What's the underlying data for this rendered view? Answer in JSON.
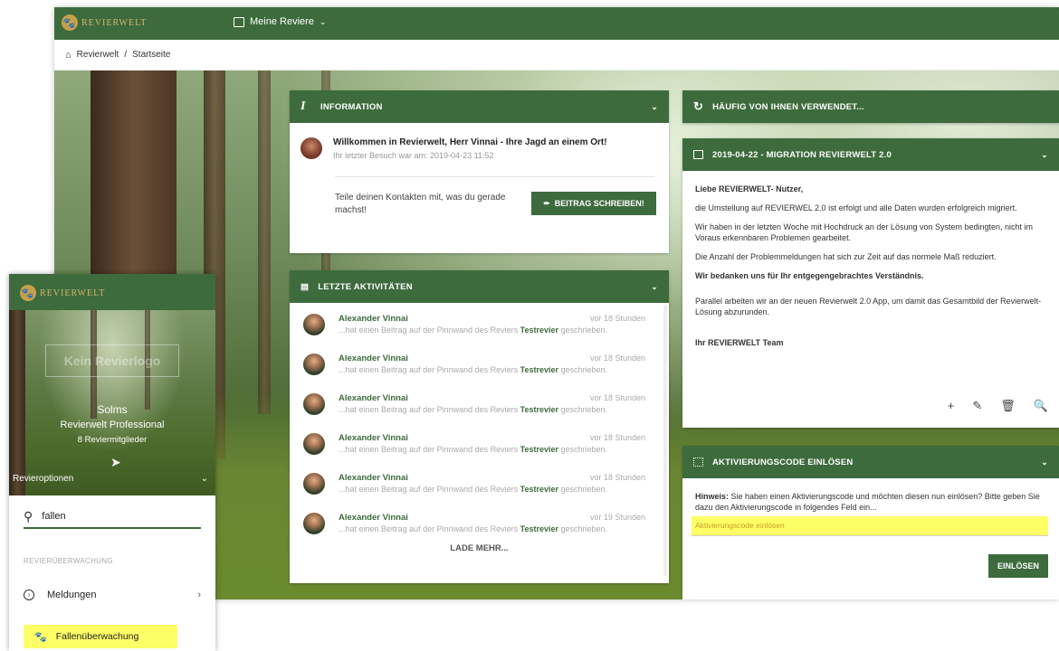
{
  "app": {
    "brand": "REVIERWELT"
  },
  "topbar": {
    "revier_menu": "Meine Reviere",
    "chevron": "⌄"
  },
  "breadcrumb": {
    "root": "Revierwelt",
    "separator": "/",
    "current": "Startseite"
  },
  "information": {
    "title": "INFORMATION",
    "welcome_title": "Willkommen in Revierwelt, Herr Vinnai - Ihre Jagd an einem Ort!",
    "welcome_sub": "Ihr letzter Besuch war am: 2019-04-23 11:52",
    "share_text": "Teile deinen Kontakten mit, was du gerade machst!",
    "post_button": "BEITRAG SCHREIBEN!"
  },
  "activities": {
    "title": "LETZTE AKTIVITÄTEN",
    "items": [
      {
        "name": "Alexander Vinnai",
        "time": "vor 18 Stunden",
        "text": "...hat einen Beitrag auf der Pinnwand des Reviers ",
        "revier": "Testrevier",
        "tail": " geschrieben."
      },
      {
        "name": "Alexander Vinnai",
        "time": "vor 18 Stunden",
        "text": "...hat einen Beitrag auf der Pinnwand des Reviers ",
        "revier": "Testrevier",
        "tail": " geschrieben."
      },
      {
        "name": "Alexander Vinnai",
        "time": "vor 18 Stunden",
        "text": "...hat einen Beitrag auf der Pinnwand des Reviers ",
        "revier": "Testrevier",
        "tail": " geschrieben."
      },
      {
        "name": "Alexander Vinnai",
        "time": "vor 18 Stunden",
        "text": "...hat einen Beitrag auf der Pinnwand des Reviers ",
        "revier": "Testrevier",
        "tail": " geschrieben."
      },
      {
        "name": "Alexander Vinnai",
        "time": "vor 18 Stunden",
        "text": "...hat einen Beitrag auf der Pinnwand des Reviers ",
        "revier": "Testrevier",
        "tail": " geschrieben."
      },
      {
        "name": "Alexander Vinnai",
        "time": "vor 19 Stunden",
        "text": "...hat einen Beitrag auf der Pinnwand des Reviers ",
        "revier": "Testrevier",
        "tail": " geschrieben."
      }
    ],
    "load_more": "LADE MEHR..."
  },
  "frequent": {
    "title": "HÄUFIG VON IHNEN VERWENDET..."
  },
  "migration": {
    "title": "2019-04-22 - MIGRATION REVIERWELT 2.0",
    "greeting": "Liebe REVIERWELT- Nutzer,",
    "p1": "die Umstellung auf REVIERWEL 2.0 ist erfolgt und alle Daten wurden erfolgreich migriert.",
    "p2": "Wir haben in der letzten Woche mit Hochdruck an der Lösung von System bedingten, nicht im Voraus erkennbaren Problemen gearbeitet.",
    "p3": "Die Anzahl der Problemmeldungen hat sich zur Zeit auf das normele Maß reduziert.",
    "p4": "Wir bedanken uns für Ihr entgegengebrachtes Verständnis.",
    "p5": "Parallel arbeiten wir an der neuen Revierwelt 2.0 App, um damit das Gesamtbild der Revierwelt-Lösung abzurunden.",
    "sign": "Ihr REVIERWELT Team",
    "tools": {
      "add": "+",
      "edit": "✎",
      "delete": "🗑",
      "search": "🔍"
    }
  },
  "code": {
    "title": "AKTIVIERUNGSCODE EINLÖSEN",
    "hint_label": "Hinweis:",
    "hint_text": " Sie haben einen Aktivierungscode und möchten diesen nun einlösen? Bitte geben Sie dazu den Aktivierungscode in folgendes Feld ein...",
    "placeholder": "Aktivierungscode einlösen",
    "button": "EINLÖSEN"
  },
  "mobile": {
    "brand": "REVIERWELT",
    "logo_placeholder": "Kein Revierlogo",
    "revier_name": "Solms",
    "revier_plan": "Revierwelt Professional",
    "revier_count": "8 Reviermitglieder",
    "options": "Revieroptionen",
    "search_value": "fallen",
    "section": "REVIERÜBERWACHUNG",
    "menu_meldungen": "Meldungen",
    "menu_fallen": "Fallenüberwachung"
  },
  "colors": {
    "primary": "#3d6b3d",
    "highlight": "#ffff66",
    "logo": "#d6b56a"
  }
}
